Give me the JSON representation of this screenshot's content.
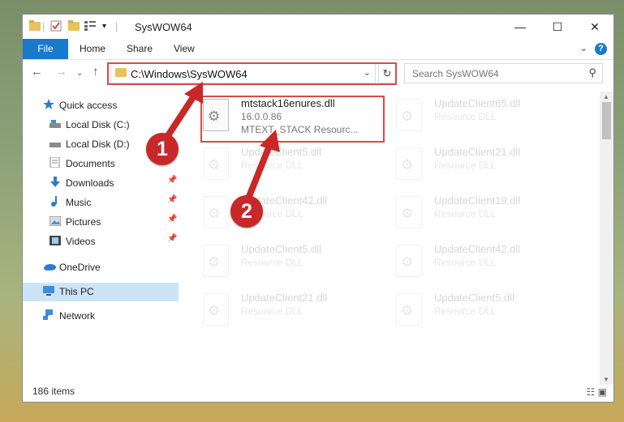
{
  "window": {
    "title": "SysWOW64"
  },
  "ribbon": {
    "file": "File",
    "tabs": [
      "Home",
      "Share",
      "View"
    ],
    "help": "?"
  },
  "address": {
    "path": "C:\\Windows\\SysWOW64"
  },
  "search": {
    "placeholder": "Search SysWOW64"
  },
  "nav": {
    "items": [
      {
        "label": "Quick access",
        "icon": "star-icon"
      },
      {
        "label": "Local Disk (C:)",
        "icon": "drive-icon"
      },
      {
        "label": "Local Disk (D:)",
        "icon": "drive-icon"
      },
      {
        "label": "Documents",
        "icon": "document-icon"
      },
      {
        "label": "Downloads",
        "icon": "download-icon"
      },
      {
        "label": "Music",
        "icon": "music-icon"
      },
      {
        "label": "Pictures",
        "icon": "pictures-icon"
      },
      {
        "label": "Videos",
        "icon": "video-icon"
      },
      {
        "label": "OneDrive",
        "icon": "cloud-icon"
      },
      {
        "label": "This PC",
        "icon": "computer-icon"
      },
      {
        "label": "Network",
        "icon": "network-icon"
      }
    ]
  },
  "files": [
    {
      "name": "mtstack16enures.dll",
      "line2": "16.0.0.86",
      "line3": "MTEXT_STACK Resourc..."
    },
    {
      "name": "UpdateClient65.dll",
      "line2": "Resource DLL"
    },
    {
      "name": "UpdateClient5.dll",
      "line2": "Resource DLL"
    },
    {
      "name": "UpdateClient21.dll",
      "line2": "Resource DLL"
    },
    {
      "name": "UpdateClient42.dll",
      "line2": "Resource DLL"
    },
    {
      "name": "UpdateClient19.dll",
      "line2": "Resource DLL"
    },
    {
      "name": "UpdateClient5.dll",
      "line2": "Resource DLL"
    },
    {
      "name": "UpdateClient42.dll",
      "line2": "Resource DLL"
    },
    {
      "name": "UpdateClient21.dll",
      "line2": "Resource DLL"
    },
    {
      "name": "UpdateClient5.dll",
      "line2": "Resource DLL"
    }
  ],
  "status": {
    "count": "186 items"
  },
  "callouts": [
    "1",
    "2"
  ],
  "colors": {
    "accent": "#1979ca",
    "highlight": "#d94b4b",
    "callout": "#c82828",
    "selected": "#cce4f7"
  }
}
